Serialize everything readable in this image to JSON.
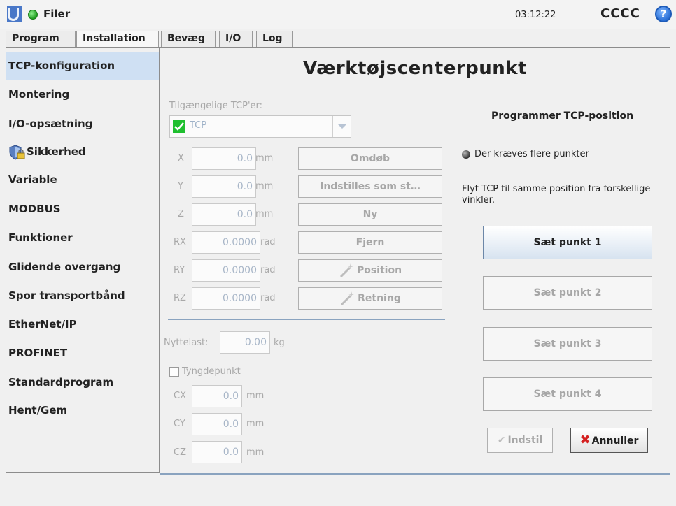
{
  "header": {
    "title": "Filer",
    "clock": "03:12:22",
    "user": "CCCC",
    "help_icon": "?"
  },
  "tabs": [
    {
      "label": "Program"
    },
    {
      "label": "Installation"
    },
    {
      "label": "Bevæg"
    },
    {
      "label": "I/O"
    },
    {
      "label": "Log"
    }
  ],
  "sidebar": {
    "items": [
      {
        "label": "TCP-konfiguration"
      },
      {
        "label": "Montering"
      },
      {
        "label": "I/O-opsætning"
      },
      {
        "label": "Sikkerhed"
      },
      {
        "label": "Variable"
      },
      {
        "label": "MODBUS"
      },
      {
        "label": "Funktioner"
      },
      {
        "label": "Glidende overgang"
      },
      {
        "label": "Spor transportbånd"
      },
      {
        "label": "EtherNet/IP"
      },
      {
        "label": "PROFINET"
      },
      {
        "label": "Standardprogram"
      },
      {
        "label": "Hent/Gem"
      }
    ]
  },
  "main": {
    "title": "Værktøjscenterpunkt",
    "tcp_label": "Tilgængelige TCP'er:",
    "tcp_selected": "TCP",
    "fields": [
      {
        "label": "X",
        "value": "0.0",
        "unit": "mm"
      },
      {
        "label": "Y",
        "value": "0.0",
        "unit": "mm"
      },
      {
        "label": "Z",
        "value": "0.0",
        "unit": "mm"
      },
      {
        "label": "RX",
        "value": "0.0000",
        "unit": "rad"
      },
      {
        "label": "RY",
        "value": "0.0000",
        "unit": "rad"
      },
      {
        "label": "RZ",
        "value": "0.0000",
        "unit": "rad"
      }
    ],
    "buttons": {
      "rename": "Omdøb",
      "set_default": "Indstilles som st…",
      "new": "Ny",
      "remove": "Fjern",
      "position": "Position",
      "orientation": "Retning"
    },
    "payload_label": "Nyttelast:",
    "payload_value": "0.00",
    "payload_unit": "kg",
    "cog_label": "Tyngdepunkt",
    "cog_fields": [
      {
        "label": "CX",
        "value": "0.0",
        "unit": "mm"
      },
      {
        "label": "CY",
        "value": "0.0",
        "unit": "mm"
      },
      {
        "label": "CZ",
        "value": "0.0",
        "unit": "mm"
      }
    ],
    "right": {
      "heading": "Programmer TCP-position",
      "status": "Der kræves flere punkter",
      "instruction": "Flyt TCP til samme position fra forskellige vinkler.",
      "points": [
        "Sæt punkt 1",
        "Sæt punkt 2",
        "Sæt punkt 3",
        "Sæt punkt 4"
      ],
      "ok": "Indstil",
      "cancel": "Annuller"
    }
  },
  "colors": {
    "selected_nav": "#cfe0f3",
    "status_green": "#1f9d1f",
    "cancel_red": "#d42020"
  }
}
